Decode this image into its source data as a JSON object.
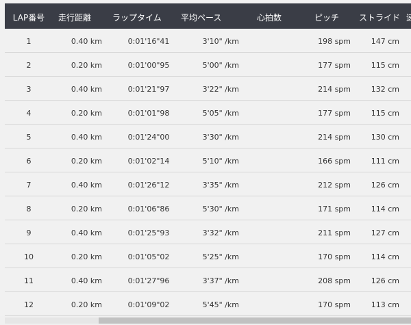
{
  "table": {
    "headers": {
      "lap": "LAP番号",
      "distance": "走行距離",
      "lap_time": "ラップタイム",
      "avg_pace": "平均ペース",
      "heart_rate": "心拍数",
      "pitch": "ピッチ",
      "stride": "ストライド",
      "next_partial": "速"
    },
    "rows": [
      {
        "lap": "1",
        "distance": "0.40 km",
        "lap_time": "0:01'16\"41",
        "avg_pace": "3'10\" /km",
        "heart_rate": "",
        "pitch": "198 spm",
        "stride": "147 cm"
      },
      {
        "lap": "2",
        "distance": "0.20 km",
        "lap_time": "0:01'00\"95",
        "avg_pace": "5'00\" /km",
        "heart_rate": "",
        "pitch": "177 spm",
        "stride": "115 cm"
      },
      {
        "lap": "3",
        "distance": "0.40 km",
        "lap_time": "0:01'21\"97",
        "avg_pace": "3'22\" /km",
        "heart_rate": "",
        "pitch": "214 spm",
        "stride": "132 cm"
      },
      {
        "lap": "4",
        "distance": "0.20 km",
        "lap_time": "0:01'01\"98",
        "avg_pace": "5'05\" /km",
        "heart_rate": "",
        "pitch": "177 spm",
        "stride": "115 cm"
      },
      {
        "lap": "5",
        "distance": "0.40 km",
        "lap_time": "0:01'24\"00",
        "avg_pace": "3'30\" /km",
        "heart_rate": "",
        "pitch": "214 spm",
        "stride": "130 cm"
      },
      {
        "lap": "6",
        "distance": "0.20 km",
        "lap_time": "0:01'02\"14",
        "avg_pace": "5'10\" /km",
        "heart_rate": "",
        "pitch": "166 spm",
        "stride": "111 cm"
      },
      {
        "lap": "7",
        "distance": "0.40 km",
        "lap_time": "0:01'26\"12",
        "avg_pace": "3'35\" /km",
        "heart_rate": "",
        "pitch": "212 spm",
        "stride": "126 cm"
      },
      {
        "lap": "8",
        "distance": "0.20 km",
        "lap_time": "0:01'06\"86",
        "avg_pace": "5'30\" /km",
        "heart_rate": "",
        "pitch": "171 spm",
        "stride": "114 cm"
      },
      {
        "lap": "9",
        "distance": "0.40 km",
        "lap_time": "0:01'25\"93",
        "avg_pace": "3'32\" /km",
        "heart_rate": "",
        "pitch": "211 spm",
        "stride": "127 cm"
      },
      {
        "lap": "10",
        "distance": "0.20 km",
        "lap_time": "0:01'05\"02",
        "avg_pace": "5'25\" /km",
        "heart_rate": "",
        "pitch": "170 spm",
        "stride": "114 cm"
      },
      {
        "lap": "11",
        "distance": "0.40 km",
        "lap_time": "0:01'27\"96",
        "avg_pace": "3'37\" /km",
        "heart_rate": "",
        "pitch": "208 spm",
        "stride": "126 cm"
      },
      {
        "lap": "12",
        "distance": "0.20 km",
        "lap_time": "0:01'09\"02",
        "avg_pace": "5'45\" /km",
        "heart_rate": "",
        "pitch": "170 spm",
        "stride": "113 cm"
      }
    ]
  },
  "colors": {
    "header_bg": "#3a3d46",
    "header_text": "#ffffff",
    "row_bg": "#f1f1f1",
    "row_divider": "#d6d6d6"
  },
  "scrollbar": {
    "horizontal_position": 0.24
  }
}
